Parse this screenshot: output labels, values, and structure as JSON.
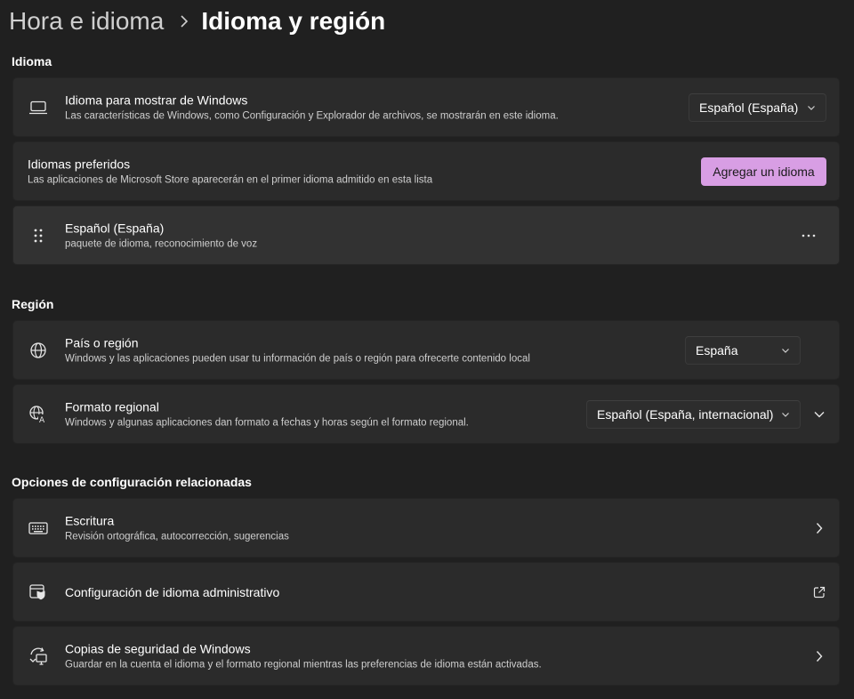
{
  "breadcrumb": {
    "parent": "Hora e idioma",
    "current": "Idioma y región"
  },
  "sections": {
    "language": "Idioma",
    "region": "Región",
    "related": "Opciones de configuración relacionadas"
  },
  "display_language": {
    "title": "Idioma para mostrar de Windows",
    "desc": "Las características de Windows, como Configuración y Explorador de archivos, se mostrarán en este idioma.",
    "value": "Español (España)",
    "icon": "laptop-icon"
  },
  "preferred_languages": {
    "title": "Idiomas preferidos",
    "desc": "Las aplicaciones de Microsoft Store aparecerán en el primer idioma admitido en esta lista",
    "add_button": "Agregar un idioma"
  },
  "language_item": {
    "title": "Español (España)",
    "desc": "paquete de idioma, reconocimiento de voz",
    "icon": "drag-handle-icon",
    "more": "more-options-icon"
  },
  "country": {
    "title": "País o región",
    "desc": "Windows y las aplicaciones pueden usar tu información de país o región para ofrecerte contenido local",
    "value": "España",
    "icon": "globe-icon"
  },
  "regional_format": {
    "title": "Formato regional",
    "desc": "Windows y algunas aplicaciones dan formato a fechas y horas según el formato regional.",
    "value": "Español (España, internacional)",
    "icon": "globe-language-icon"
  },
  "typing": {
    "title": "Escritura",
    "desc": "Revisión ortográfica, autocorrección, sugerencias",
    "icon": "keyboard-icon"
  },
  "admin_language": {
    "title": "Configuración de idioma administrativo",
    "icon": "admin-shield-icon"
  },
  "backup": {
    "title": "Copias de seguridad de Windows",
    "desc": "Guardar en la cuenta el idioma y el formato regional mientras las preferencias de idioma están activadas.",
    "icon": "backup-sync-icon"
  },
  "colors": {
    "accent": "#d89ee4",
    "background": "#202020",
    "card": "#2b2b2b"
  }
}
